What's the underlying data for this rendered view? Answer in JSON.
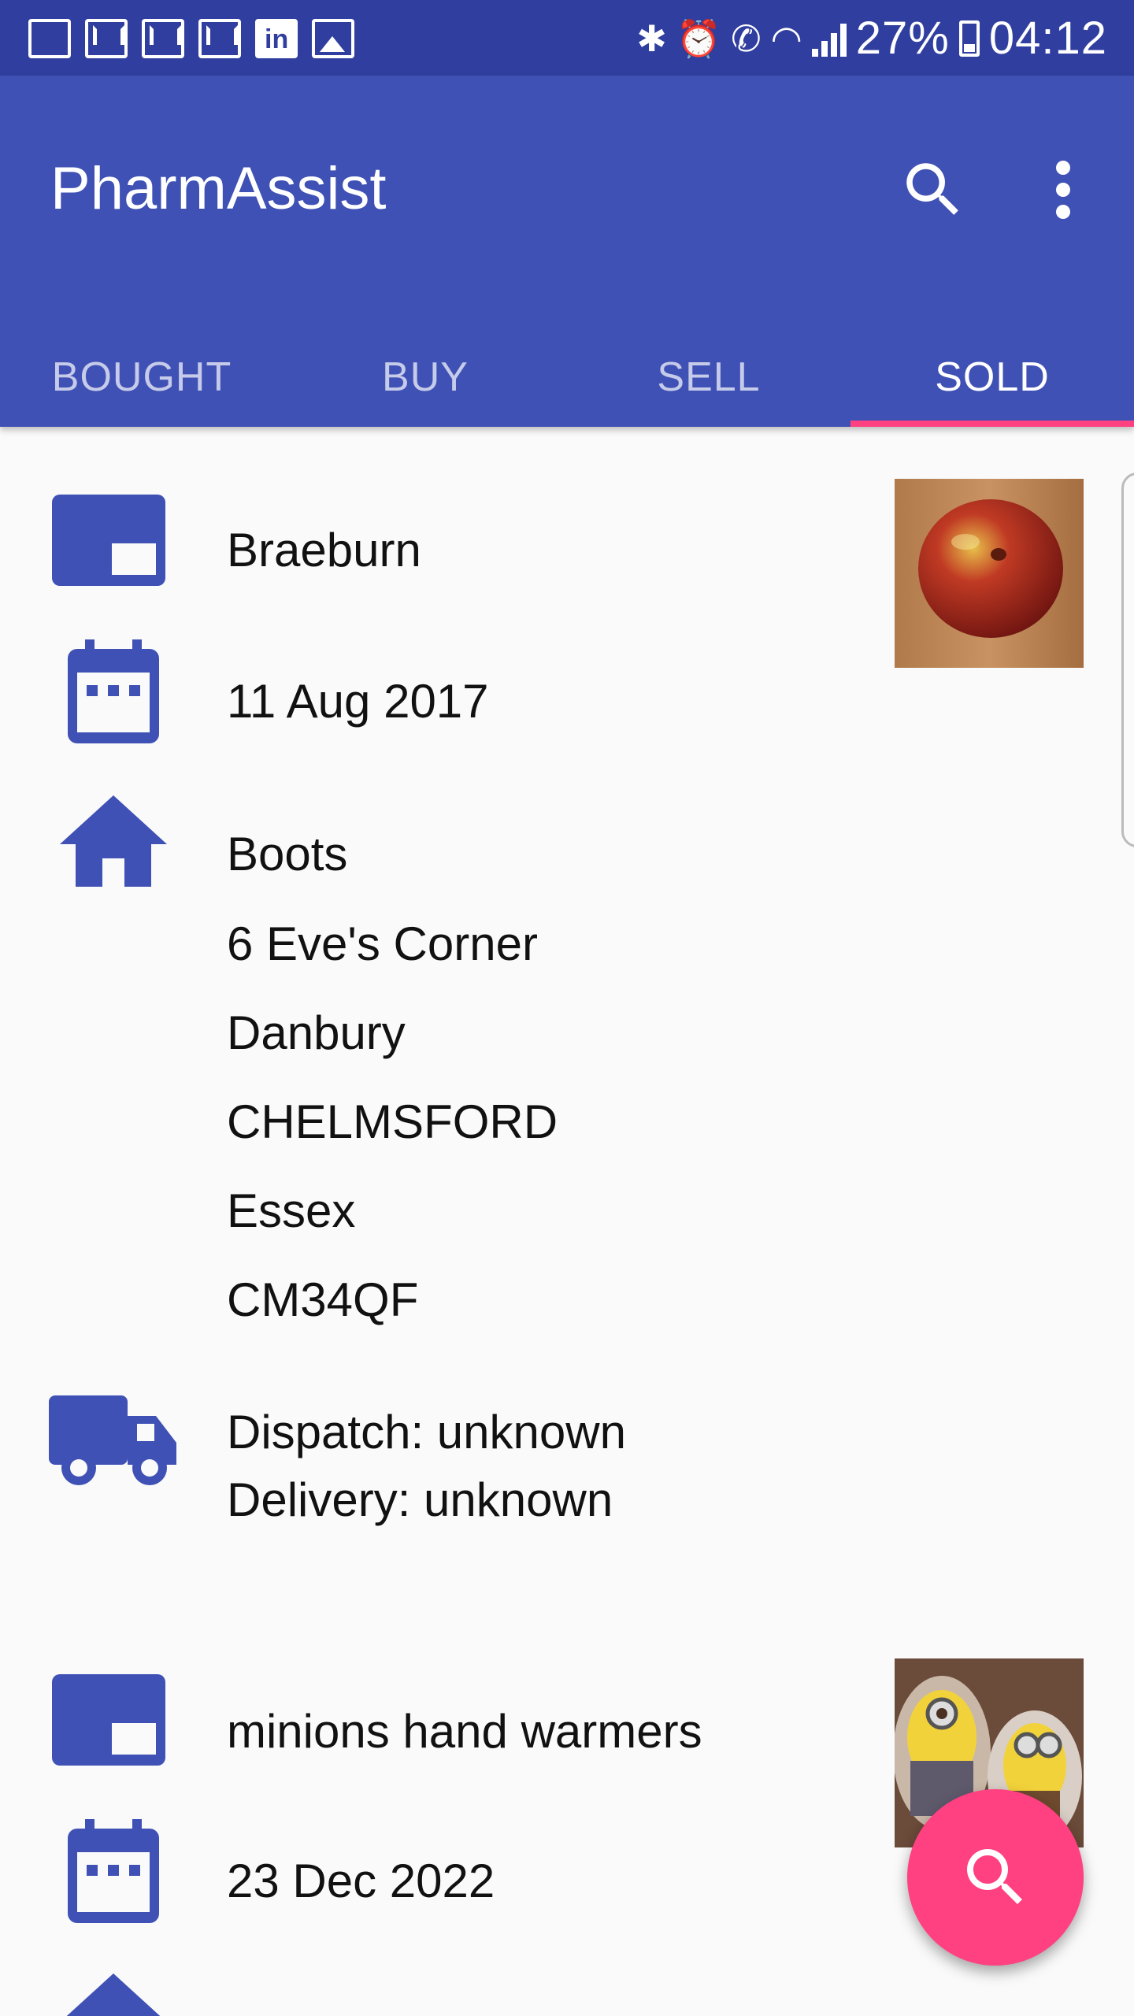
{
  "status_bar": {
    "left_icons": [
      "mosque-icon",
      "gmail-icon",
      "gmail-stack-icon",
      "gmail-icon",
      "linkedin-icon",
      "image-icon"
    ],
    "battery_percent": "27%",
    "time": "04:12"
  },
  "app_bar": {
    "title": "PharmAssist",
    "actions": [
      "search-icon",
      "more-vert-icon"
    ]
  },
  "tabs": [
    {
      "label": "BOUGHT",
      "active": false
    },
    {
      "label": "BUY",
      "active": false
    },
    {
      "label": "SELL",
      "active": false
    },
    {
      "label": "SOLD",
      "active": true
    }
  ],
  "items": [
    {
      "name": "Braeburn",
      "date": "11 Aug 2017",
      "seller": [
        "Boots",
        "6 Eve's Corner",
        "Danbury",
        "CHELMSFORD",
        "Essex",
        "CM34QF"
      ],
      "dispatch": "Dispatch: unknown",
      "delivery": "Delivery: unknown",
      "thumbnail": "apple photo"
    },
    {
      "name": "minions hand warmers",
      "date": "23 Dec 2022",
      "thumbnail": "minions hand warmers photo"
    }
  ],
  "fab": {
    "icon": "search-icon"
  },
  "colors": {
    "primary": "#3f51b5",
    "primary_dark": "#303f9f",
    "accent": "#ff4081",
    "icon": "#3f51b5"
  }
}
